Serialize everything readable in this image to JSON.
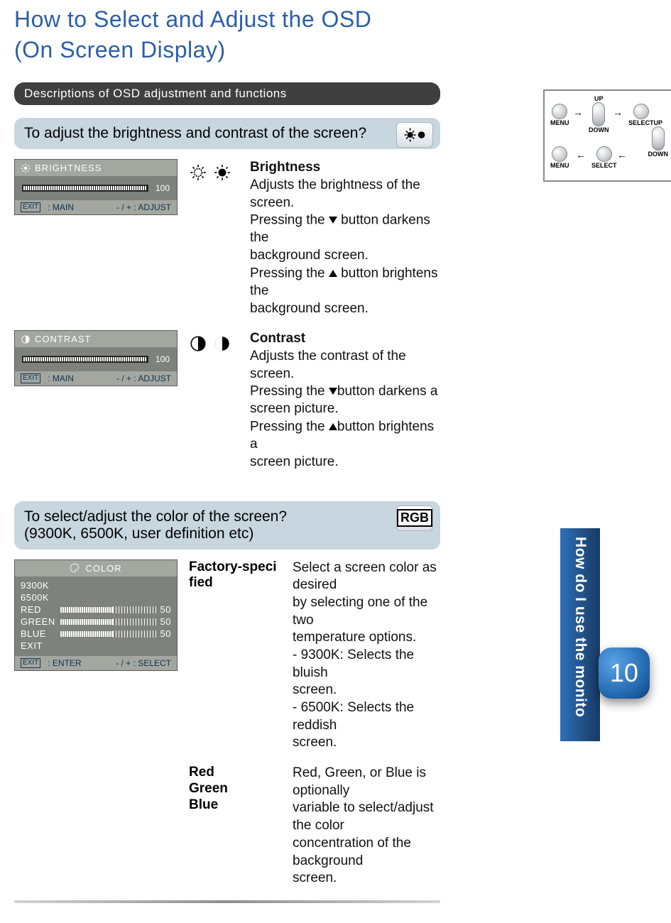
{
  "title_line1": "How to Select and Adjust the OSD",
  "title_line2": "(On Screen Display)",
  "section_bar": "Descriptions of OSD adjustment and functions",
  "subhead1": "To adjust the brightness and contrast of the screen?",
  "brightness_osd": {
    "header": "BRIGHTNESS",
    "value": "100",
    "footer_left": ": MAIN",
    "footer_right": "- / + : ADJUST"
  },
  "brightness": {
    "heading": "Brightness",
    "l1": "Adjusts the brightness of the screen.",
    "l2a": "Pressing the ",
    "l2b": " button darkens the",
    "l3": "background screen.",
    "l4a": "Pressing the ",
    "l4b": " button brightens the",
    "l5": "background screen."
  },
  "contrast_osd": {
    "header": "CONTRAST",
    "value": "100",
    "footer_left": ": MAIN",
    "footer_right": "- / + : ADJUST"
  },
  "contrast": {
    "heading": "Contrast",
    "l1": "Adjusts the contrast of the screen.",
    "l2a": "Pressing the ",
    "l2b": "button darkens a",
    "l3": "screen picture.",
    "l4a": "Pressing the ",
    "l4b": "button brightens a",
    "l5": "screen picture."
  },
  "subhead2_l1": "To select/adjust the color of the screen?",
  "subhead2_l2": "(9300K, 6500K, user definition etc)",
  "rgb_badge": "RGB",
  "color_osd": {
    "header": "COLOR",
    "k1": "9300K",
    "k2": "6500K",
    "red": "RED",
    "green": "GREEN",
    "blue": "BLUE",
    "exit": "EXIT",
    "val": "50",
    "footer_left": ": ENTER",
    "footer_right": "- / + : SELECT"
  },
  "factory_label_l1": "Factory-speci",
  "factory_label_l2": "fied",
  "factory_desc": {
    "l1": "Select a screen color as desired",
    "l2": "by selecting one of the two",
    "l3": "temperature options.",
    "l4": "- 9300K: Selects the bluish",
    "l5": "screen.",
    "l6": "- 6500K: Selects the reddish",
    "l7": "screen."
  },
  "rgb_labels": {
    "r": "Red",
    "g": "Green",
    "b": "Blue"
  },
  "rgb_desc": {
    "l1": "Red, Green, or Blue is optionally",
    "l2": "variable to select/adjust the color",
    "l3": "concentration of the background",
    "l4": "screen."
  },
  "diagram": {
    "menu": "MENU",
    "up": "UP",
    "down": "DOWN",
    "select": "SELECT"
  },
  "side_tab": "How do I use the monito",
  "page_number": "10"
}
